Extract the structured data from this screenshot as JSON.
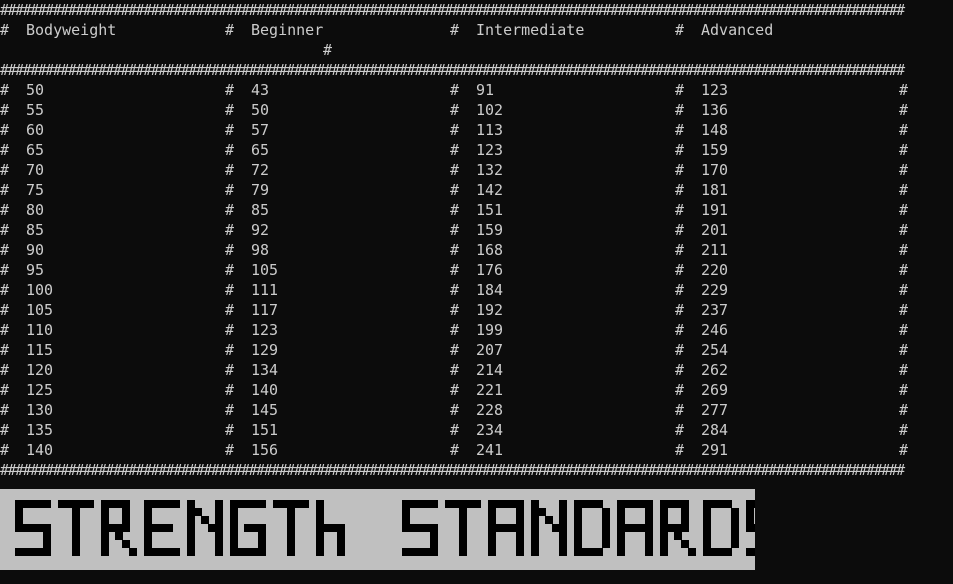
{
  "window": {
    "rule_char": "#"
  },
  "table": {
    "headers": [
      "Bodyweight",
      "Beginner",
      "Intermediate",
      "Advanced"
    ],
    "header_wrap_hash": "#",
    "rows": [
      [
        "50",
        "43",
        "91",
        "123"
      ],
      [
        "55",
        "50",
        "102",
        "136"
      ],
      [
        "60",
        "57",
        "113",
        "148"
      ],
      [
        "65",
        "65",
        "123",
        "159"
      ],
      [
        "70",
        "72",
        "132",
        "170"
      ],
      [
        "75",
        "79",
        "142",
        "181"
      ],
      [
        "80",
        "85",
        "151",
        "191"
      ],
      [
        "85",
        "92",
        "159",
        "201"
      ],
      [
        "90",
        "98",
        "168",
        "211"
      ],
      [
        "95",
        "105",
        "176",
        "220"
      ],
      [
        "100",
        "111",
        "184",
        "229"
      ],
      [
        "105",
        "117",
        "192",
        "237"
      ],
      [
        "110",
        "123",
        "199",
        "246"
      ],
      [
        "115",
        "129",
        "207",
        "254"
      ],
      [
        "120",
        "134",
        "214",
        "262"
      ],
      [
        "125",
        "140",
        "221",
        "269"
      ],
      [
        "130",
        "145",
        "228",
        "277"
      ],
      [
        "135",
        "151",
        "234",
        "284"
      ],
      [
        "140",
        "156",
        "241",
        "291"
      ]
    ]
  },
  "banner": {
    "text": "STRENGTH STANDARDS"
  },
  "colors": {
    "background": "#0c0c0c",
    "foreground": "#cccccc",
    "banner_bg": "#c0c0c0",
    "banner_fg": "#000000"
  }
}
